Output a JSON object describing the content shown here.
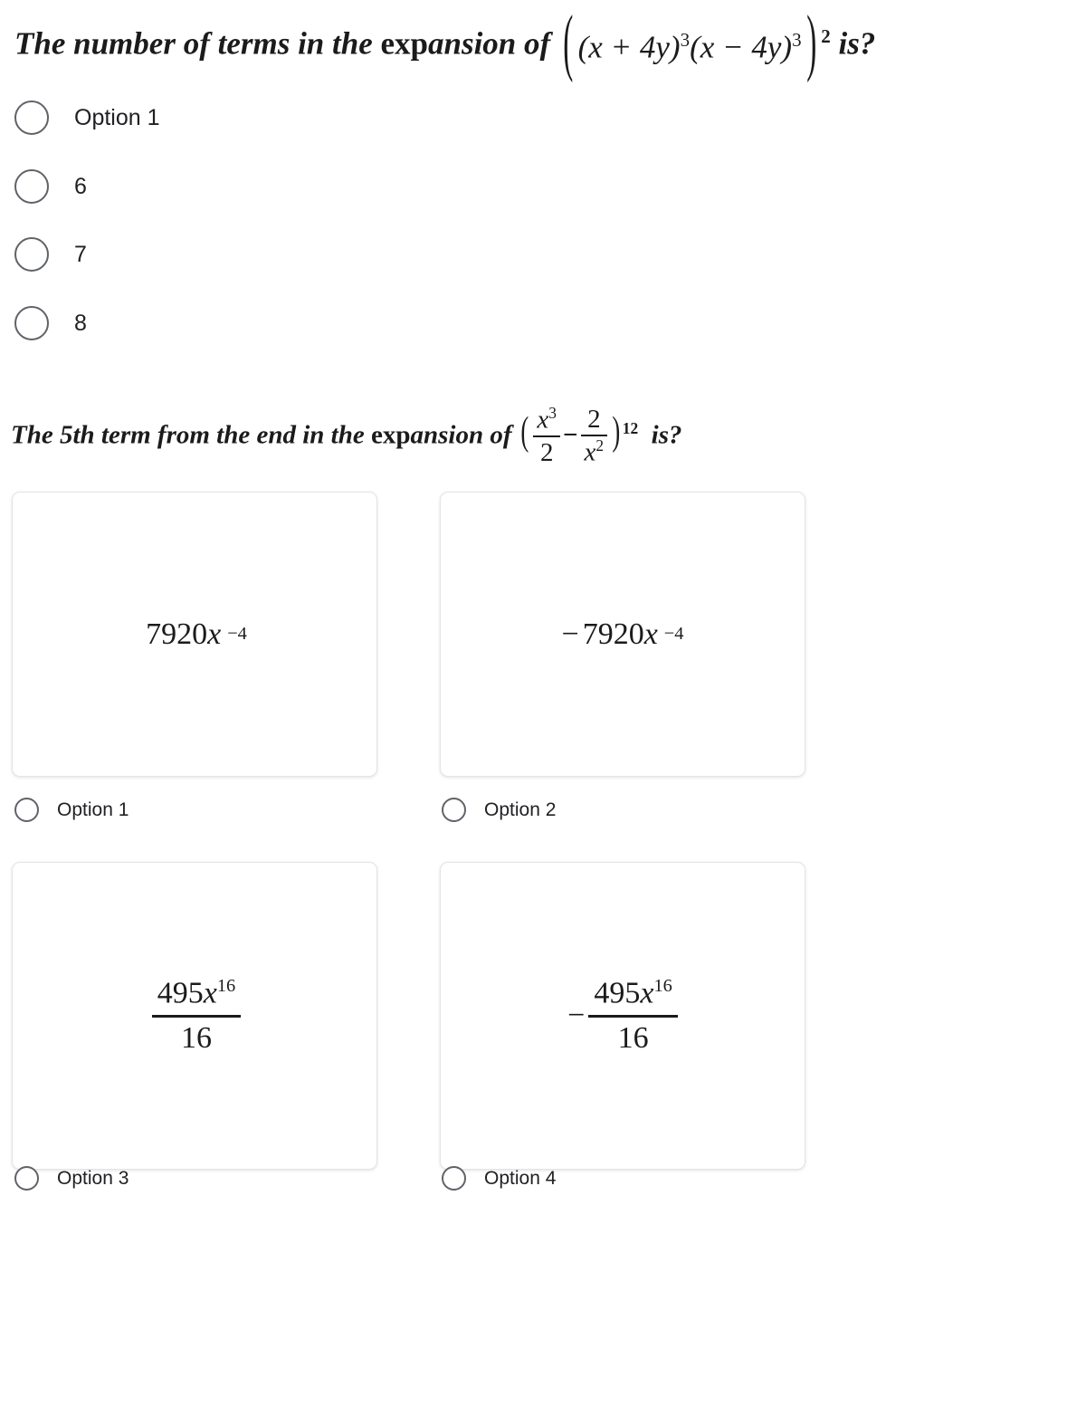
{
  "page": {
    "background": "#ffffff",
    "text_color": "#202124",
    "radio_border_color": "#5f6368",
    "card_border_color": "#e4e4e4"
  },
  "question1": {
    "prefix": "The number of terms in the ",
    "exp_word": "exp",
    "ansion_of": "ansion of ",
    "formula_open": "((",
    "term1_base": "x + 4y",
    "term1_exp": "3",
    "term2_base": "x − 4y",
    "term2_exp": "3",
    "outer_exp": "2",
    "tail": "is?",
    "full_text": "The number of terms in the expansion of ((x + 4y)³(x − 4y)³)² is?",
    "options": [
      {
        "id": "q1-opt1",
        "label": "Option 1"
      },
      {
        "id": "q1-opt2",
        "label": "6"
      },
      {
        "id": "q1-opt3",
        "label": "7"
      },
      {
        "id": "q1-opt4",
        "label": "8"
      }
    ]
  },
  "question2": {
    "prefix": "The 5th term from the end in the ",
    "exp_word": "exp",
    "ansion_of": "ansion of ",
    "frac1_num": "x",
    "frac1_num_exp": "3",
    "frac1_den": "2",
    "minus": "−",
    "frac2_num": "2",
    "frac2_den": "x",
    "frac2_den_exp": "2",
    "outer_exp": "12",
    "tail": "is?",
    "full_text": "The 5th term from the end in the expansion of (x³/2 − 2/x²)^12 is?",
    "cards": [
      {
        "id": "q2-card1",
        "type": "power",
        "sign": "",
        "coefficient": "7920",
        "variable": "x",
        "exponent": "−4",
        "plain": "7920x⁻⁴"
      },
      {
        "id": "q2-card2",
        "type": "power",
        "sign": "−",
        "coefficient": "7920",
        "variable": "x",
        "exponent": "−4",
        "plain": "−7920x⁻⁴"
      },
      {
        "id": "q2-card3",
        "type": "fraction",
        "sign": "",
        "numerator_coefficient": "495",
        "numerator_variable": "x",
        "numerator_exponent": "16",
        "denominator": "16",
        "plain": "495x¹⁶ / 16"
      },
      {
        "id": "q2-card4",
        "type": "fraction",
        "sign": "−",
        "numerator_coefficient": "495",
        "numerator_variable": "x",
        "numerator_exponent": "16",
        "denominator": "16",
        "plain": "−495x¹⁶ / 16"
      }
    ],
    "options": [
      {
        "id": "q2-opt1",
        "label": "Option 1"
      },
      {
        "id": "q2-opt2",
        "label": "Option 2"
      },
      {
        "id": "q2-opt3",
        "label": "Option 3"
      },
      {
        "id": "q2-opt4",
        "label": "Option 4"
      }
    ]
  }
}
